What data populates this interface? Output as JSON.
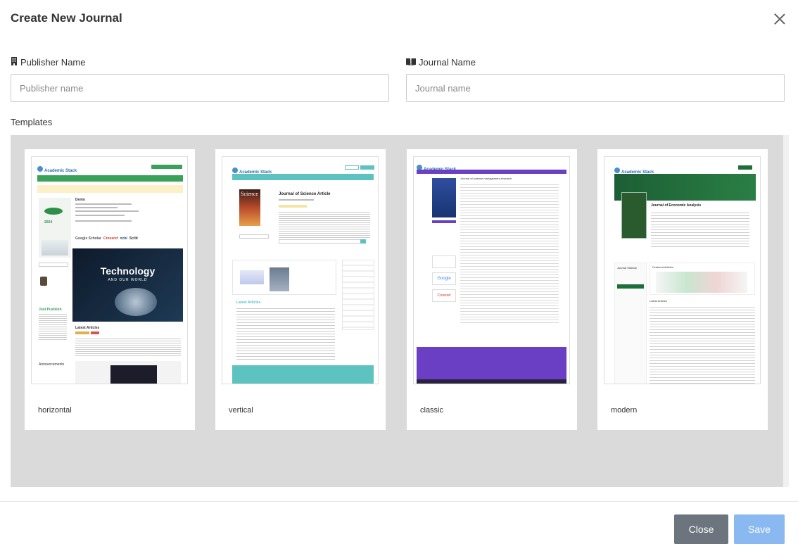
{
  "modal": {
    "title": "Create New Journal"
  },
  "form": {
    "publisher": {
      "label": "Publisher Name",
      "placeholder": "Publisher name",
      "value": ""
    },
    "journal": {
      "label": "Journal Name",
      "placeholder": "Journal name",
      "value": ""
    },
    "templates_label": "Templates"
  },
  "templates": [
    {
      "name": "horizontal"
    },
    {
      "name": "vertical"
    },
    {
      "name": "classic"
    },
    {
      "name": "modern"
    }
  ],
  "thumbnails": {
    "horizontal": {
      "logo": "Academic Stack",
      "journal_title": "Demo",
      "year": "2024",
      "partners": [
        "Google Scholar",
        "Crossref",
        "ncbi",
        "Scilit"
      ],
      "banner_title": "Technology",
      "banner_subtitle": "AND OUR WORLD",
      "section": "Latest Articles",
      "aside": "Just Pusblish",
      "announcements": "Announcements"
    },
    "vertical": {
      "logo": "Academic Stack",
      "cover_text": "Science",
      "journal_title": "Journal of Science Article",
      "section": "Latest Articles"
    },
    "classic": {
      "logo": "Academic Stack",
      "journal_title": "Journal of science management research",
      "partners": [
        "Google",
        "Crossref"
      ]
    },
    "modern": {
      "logo": "Academic Stack",
      "journal_title": "Journal of Economic Analysis",
      "section_a": "Journal Sidebar",
      "section_b": "Featured Articles",
      "section_c": "Latest Articles"
    }
  },
  "buttons": {
    "close": "Close",
    "save": "Save"
  },
  "colors": {
    "horizontal_accent": "#3aa15a",
    "vertical_accent": "#5cc3c1",
    "classic_accent": "#6a3fc4",
    "modern_accent": "#1e6e3a",
    "save_button": "#8ab8f0",
    "close_button": "#6c757d"
  }
}
